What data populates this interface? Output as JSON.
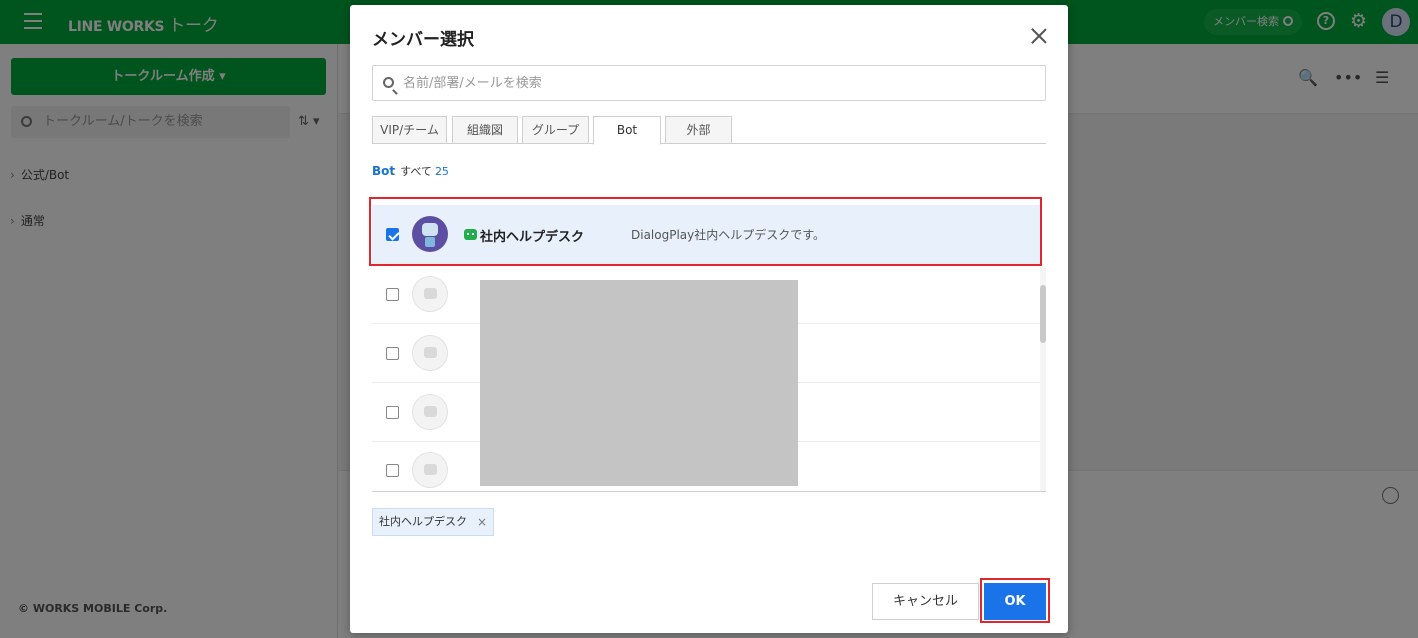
{
  "app": {
    "brand": "LINE WORKS",
    "brand_sub": "トーク",
    "member_search": "メンバー検索",
    "help_glyph": "?",
    "settings_glyph": "⚙",
    "avatar_initial": "D"
  },
  "sidebar": {
    "create_button": "トークルーム作成",
    "search_placeholder": "トークルーム/トークを検索",
    "sort_glyph": "⇅",
    "groups": [
      {
        "label": "公式/Bot"
      },
      {
        "label": "通常"
      }
    ],
    "copyright": "© WORKS MOBILE Corp."
  },
  "main": {
    "search_glyph": "🔍",
    "more_glyph": "•••",
    "menu_glyph": "☰"
  },
  "modal": {
    "title": "メンバー選択",
    "search_placeholder": "名前/部署/メールを検索",
    "tabs": [
      {
        "label": "VIP/チーム",
        "active": false
      },
      {
        "label": "組織図",
        "active": false
      },
      {
        "label": "グループ",
        "active": false
      },
      {
        "label": "Bot",
        "active": true
      },
      {
        "label": "外部",
        "active": false
      }
    ],
    "filter": {
      "category": "Bot",
      "scope": "すべて",
      "count": "25"
    },
    "rows": [
      {
        "name": "社内ヘルプデスク",
        "description": "DialogPlay社内ヘルプデスクです。",
        "checked": true
      },
      {
        "name": "",
        "description": "",
        "checked": false
      },
      {
        "name": "",
        "description": "",
        "checked": false
      },
      {
        "name": "",
        "description": "",
        "checked": false
      },
      {
        "name": "",
        "description": "",
        "checked": false
      }
    ],
    "selected_chips": [
      {
        "label": "社内ヘルプデスク",
        "remove": "×"
      }
    ],
    "cancel_label": "キャンセル",
    "ok_label": "OK"
  },
  "colors": {
    "brand_green": "#00a83a",
    "primary_blue": "#1a73e8",
    "highlight_red": "#e0262f",
    "selected_row": "#e7f0fb"
  }
}
